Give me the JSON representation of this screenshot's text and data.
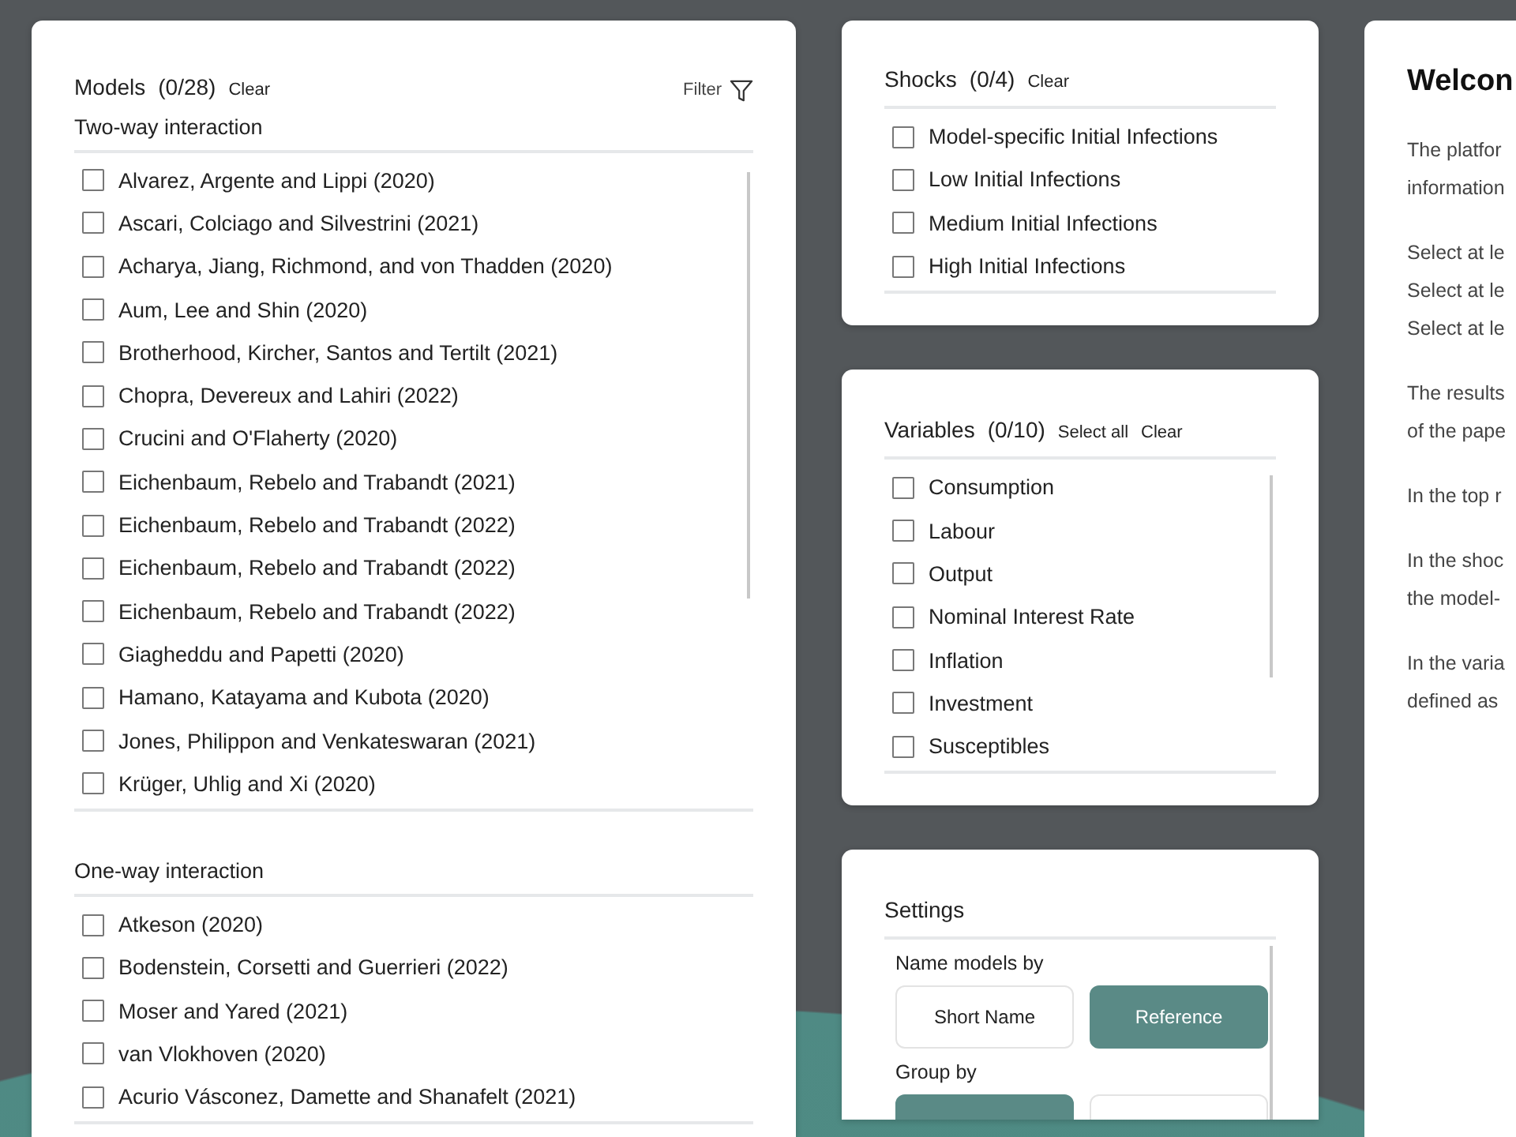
{
  "models": {
    "title": "Models",
    "count": "(0/28)",
    "clear": "Clear",
    "filter": "Filter",
    "groups": [
      {
        "title": "Two-way interaction",
        "scroll": true,
        "items": [
          {
            "label": "Alvarez, Argente and Lippi (2020)",
            "checked": false
          },
          {
            "label": "Ascari, Colciago and Silvestrini (2021)",
            "checked": false
          },
          {
            "label": "Acharya, Jiang, Richmond, and von Thadden (2020)",
            "checked": false
          },
          {
            "label": "Aum, Lee and Shin (2020)",
            "checked": false
          },
          {
            "label": "Brotherhood, Kircher, Santos and Tertilt (2021)",
            "checked": false
          },
          {
            "label": "Chopra, Devereux and Lahiri (2022)",
            "checked": false
          },
          {
            "label": "Crucini and O'Flaherty (2020)",
            "checked": false
          },
          {
            "label": "Eichenbaum, Rebelo and Trabandt (2021)",
            "checked": false
          },
          {
            "label": "Eichenbaum, Rebelo and Trabandt (2022)",
            "checked": false
          },
          {
            "label": "Eichenbaum, Rebelo and Trabandt (2022)",
            "checked": false
          },
          {
            "label": "Eichenbaum, Rebelo and Trabandt (2022)",
            "checked": false
          },
          {
            "label": "Giagheddu and Papetti (2020)",
            "checked": false
          },
          {
            "label": "Hamano, Katayama and Kubota (2020)",
            "checked": false
          },
          {
            "label": "Jones, Philippon and Venkateswaran (2021)",
            "checked": false
          },
          {
            "label": "Krüger, Uhlig and Xi (2020)",
            "checked": false
          }
        ]
      },
      {
        "title": "One-way interaction",
        "scroll": false,
        "items": [
          {
            "label": "Atkeson (2020)",
            "checked": false
          },
          {
            "label": "Bodenstein, Corsetti and Guerrieri (2022)",
            "checked": false
          },
          {
            "label": "Moser and Yared (2021)",
            "checked": false
          },
          {
            "label": "van Vlokhoven (2020)",
            "checked": false
          },
          {
            "label": "Acurio Vásconez, Damette and Shanafelt (2021)",
            "checked": false
          }
        ]
      }
    ]
  },
  "shocks": {
    "title": "Shocks",
    "count": "(0/4)",
    "clear": "Clear",
    "items": [
      {
        "label": "Model-specific Initial Infections",
        "checked": false
      },
      {
        "label": "Low Initial Infections",
        "checked": false
      },
      {
        "label": "Medium Initial Infections",
        "checked": false
      },
      {
        "label": "High Initial Infections",
        "checked": false
      }
    ]
  },
  "variables": {
    "title": "Variables",
    "count": "(0/10)",
    "select_all": "Select all",
    "clear": "Clear",
    "items": [
      {
        "label": "Consumption",
        "checked": false
      },
      {
        "label": "Labour",
        "checked": false
      },
      {
        "label": "Output",
        "checked": false
      },
      {
        "label": "Nominal Interest Rate",
        "checked": false
      },
      {
        "label": "Inflation",
        "checked": false
      },
      {
        "label": "Investment",
        "checked": false
      },
      {
        "label": "Susceptibles",
        "checked": false
      }
    ]
  },
  "settings": {
    "title": "Settings",
    "groups": [
      {
        "label": "Name models by",
        "options": [
          {
            "label": "Short Name",
            "selected": false
          },
          {
            "label": "Reference",
            "selected": true
          }
        ]
      },
      {
        "label": "Group by",
        "options": [
          {
            "selected": true
          },
          {
            "selected": false
          }
        ]
      }
    ]
  },
  "welcome": {
    "title": "Welcon",
    "paragraphs": [
      [
        "The platfor",
        "information"
      ],
      [
        "Select at le",
        "Select at le",
        "Select at le"
      ],
      [
        "The results",
        "of the pape"
      ],
      [
        "In the top r"
      ],
      [
        "In the shoc",
        "the model-"
      ],
      [
        "In the varia",
        "defined as"
      ]
    ]
  }
}
